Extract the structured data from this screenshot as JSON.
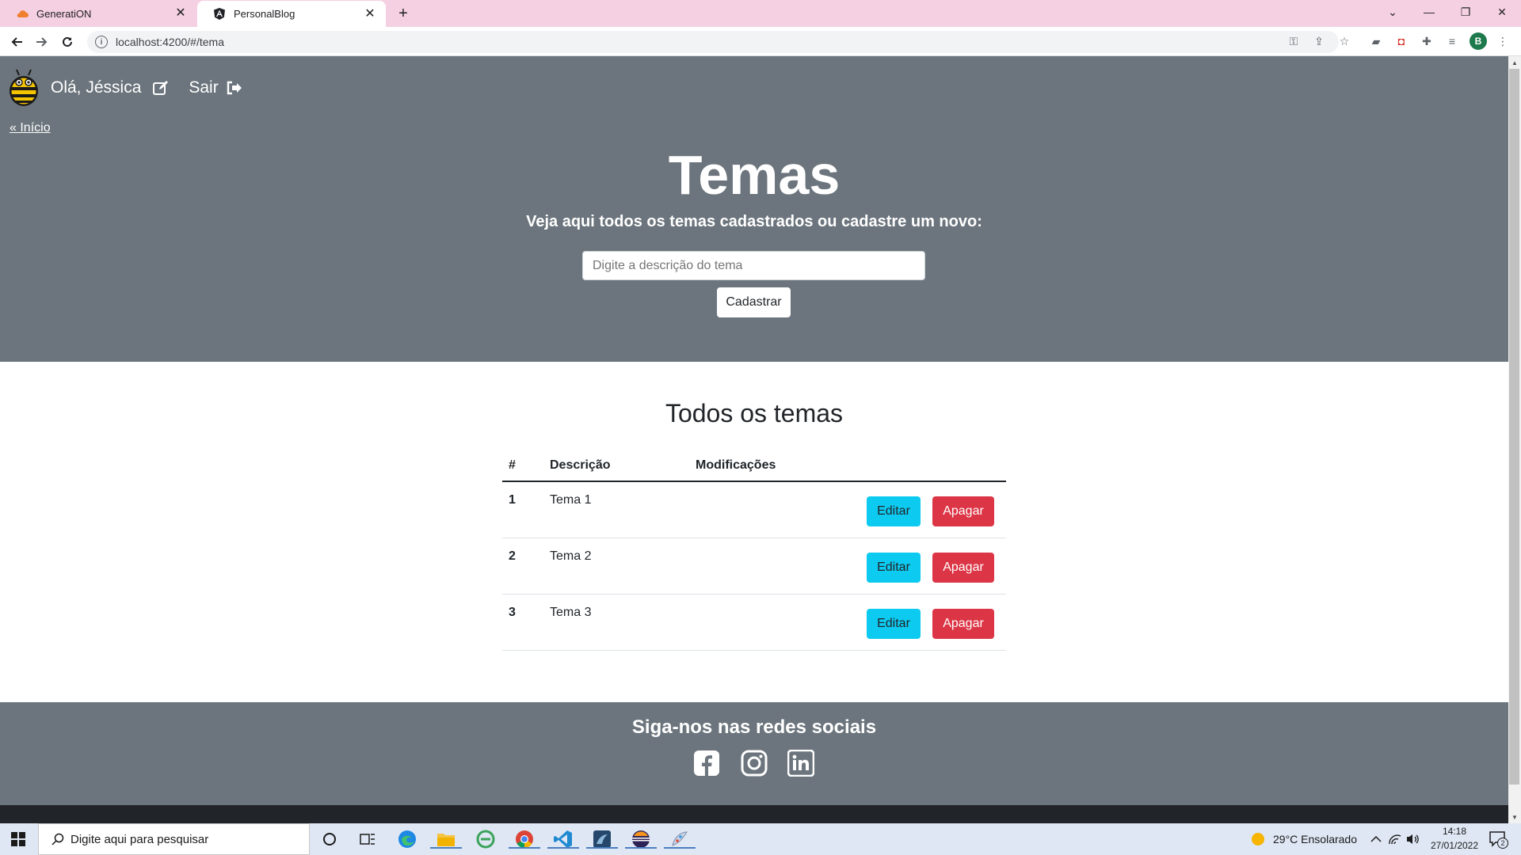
{
  "browser": {
    "tabs": [
      {
        "title": "GeneratiON",
        "active": false
      },
      {
        "title": "PersonalBlog",
        "active": true
      }
    ],
    "url": "localhost:4200/#/tema",
    "profile_initial": "B"
  },
  "navbar": {
    "greeting": "Olá, Jéssica",
    "logout_label": "Sair"
  },
  "back_link": "« Início",
  "hero": {
    "title": "Temas",
    "subtitle": "Veja aqui todos os temas cadastrados ou cadastre um novo:",
    "input_placeholder": "Digite a descrição do tema",
    "submit_label": "Cadastrar"
  },
  "list": {
    "title": "Todos os temas",
    "headers": [
      "#",
      "Descrição",
      "Modificações"
    ],
    "rows": [
      {
        "id": "1",
        "description": "Tema 1"
      },
      {
        "id": "2",
        "description": "Tema 2"
      },
      {
        "id": "3",
        "description": "Tema 3"
      }
    ],
    "edit_label": "Editar",
    "delete_label": "Apagar"
  },
  "footer": {
    "title": "Siga-nos nas redes sociais",
    "socials": [
      "facebook-icon",
      "instagram-icon",
      "linkedin-icon"
    ]
  },
  "taskbar": {
    "search_placeholder": "Digite aqui para pesquisar",
    "weather": "29°C  Ensolarado",
    "time": "14:18",
    "date": "27/01/2022",
    "notification_count": "2"
  },
  "colors": {
    "hero_bg": "#6c757d",
    "edit_btn": "#0dcaf0",
    "delete_btn": "#dc3545"
  }
}
